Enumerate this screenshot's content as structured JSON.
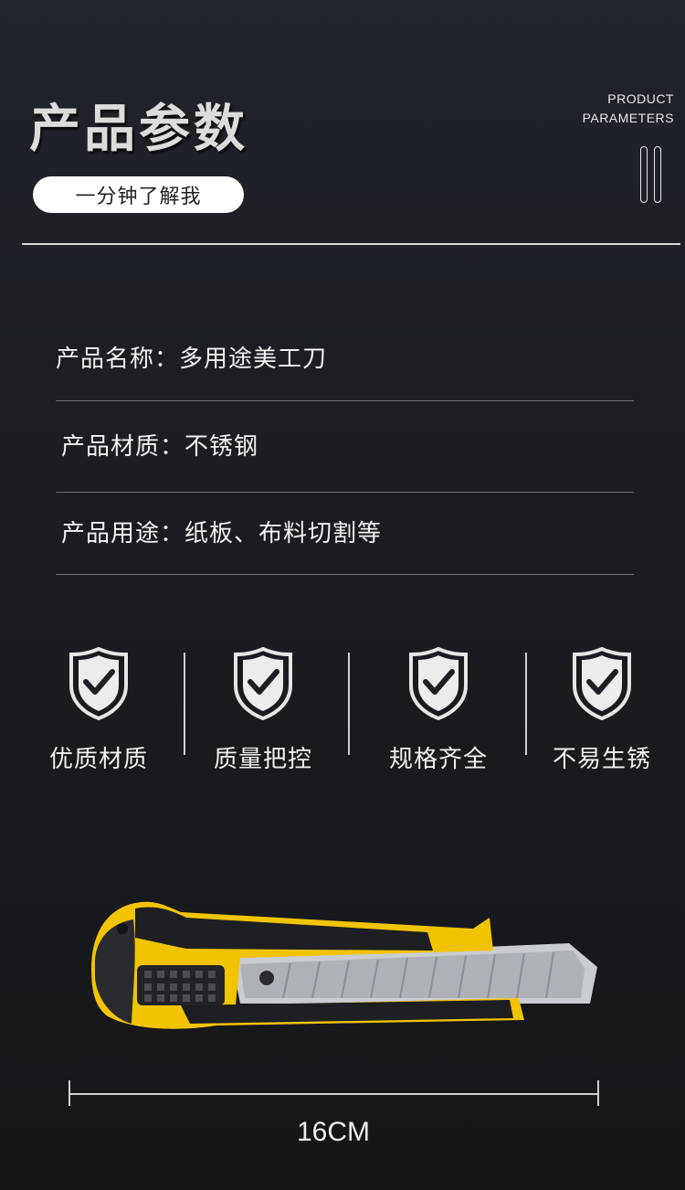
{
  "header": {
    "title": "产品参数",
    "subtitle_pill": "一分钟了解我",
    "en_line1": "PRODUCT",
    "en_line2": "PARAMETERS"
  },
  "params": [
    {
      "text": "产品名称：多用途美工刀"
    },
    {
      "text": "产品材质：不锈钢"
    },
    {
      "text": "产品用途：纸板、布料切割等"
    }
  ],
  "features": [
    {
      "label": "优质材质",
      "icon": "shield-check-icon"
    },
    {
      "label": "质量把控",
      "icon": "shield-check-icon"
    },
    {
      "label": "规格齐全",
      "icon": "shield-check-icon"
    },
    {
      "label": "不易生锈",
      "icon": "shield-check-icon"
    }
  ],
  "product": {
    "image": "utility-knife-yellow-black",
    "dimension_label": "16CM"
  },
  "colors": {
    "background": "#1b1d22",
    "text": "#f2f2f2",
    "accent_yellow": "#f5c800"
  }
}
